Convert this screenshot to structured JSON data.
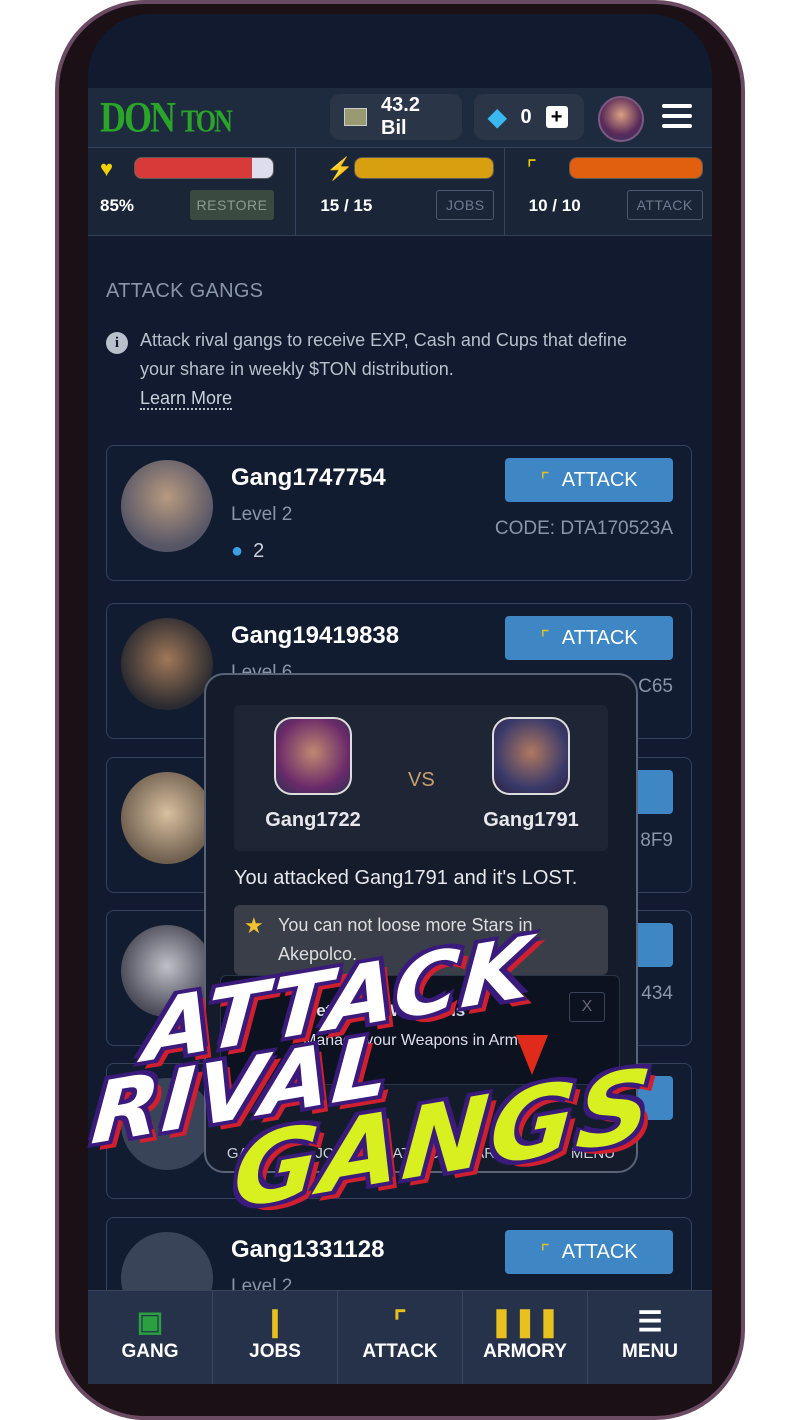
{
  "header": {
    "logo": "DON TON",
    "logo_main": "DON",
    "logo_sub": "TON",
    "cash": "43.2 Bil",
    "gems": "0",
    "plus_label": "+"
  },
  "stats": [
    {
      "icon": "heart-icon",
      "value": "85%",
      "button": "RESTORE",
      "fill_percent": 85,
      "color": "#d83a3a"
    },
    {
      "icon": "lightning-icon",
      "value": "15 / 15",
      "button": "JOBS",
      "fill_percent": 100,
      "color": "#d8a010"
    },
    {
      "icon": "pistol-icon",
      "value": "10 / 10",
      "button": "ATTACK",
      "fill_percent": 100,
      "color": "#e06010"
    }
  ],
  "section_title": "ATTACK GANGS",
  "info_text": "Attack rival gangs to receive EXP, Cash and Cups that define your share in weekly $TON distribution.",
  "learn_more": "Learn More",
  "attack_label": "ATTACK",
  "gangs": [
    {
      "name": "Gang1747754",
      "level": "Level 2",
      "members": "2",
      "code": "CODE: DTA170523A"
    },
    {
      "name": "Gang19419838",
      "level": "Level 6",
      "code": "C65"
    },
    {
      "code": "8F9"
    },
    {
      "code": "434"
    },
    {},
    {
      "name": "Gang1331128",
      "level": "Level 2"
    }
  ],
  "modal": {
    "player": "Gang1722",
    "vs": "VS",
    "opponent": "Gang1791",
    "result": "You attacked Gang1791 and it's LOST.",
    "star_note": "You can not loose more Stars in Akepolco.",
    "toast_title": "Get Better Weapons",
    "toast_text": "Manage your Weapons in Armory",
    "toast_close": "X",
    "nav": [
      "GANG",
      "JOBS",
      "ATTACK",
      "ARMORY",
      "MENU"
    ]
  },
  "nav": [
    {
      "label": "GANG",
      "icon": "gang-badge-icon"
    },
    {
      "label": "JOBS",
      "icon": "radio-tower-icon"
    },
    {
      "label": "ATTACK",
      "icon": "pistol-icon"
    },
    {
      "label": "ARMORY",
      "icon": "bullets-icon"
    },
    {
      "label": "MENU",
      "icon": "hamburger-icon"
    }
  ],
  "promo": {
    "line1": "ATTACK",
    "line2": "RIVAL",
    "line3": "GANGS"
  },
  "colors": {
    "accent": "#3f86c4",
    "background": "#111a2e",
    "promo_yellow": "#d8f020"
  }
}
